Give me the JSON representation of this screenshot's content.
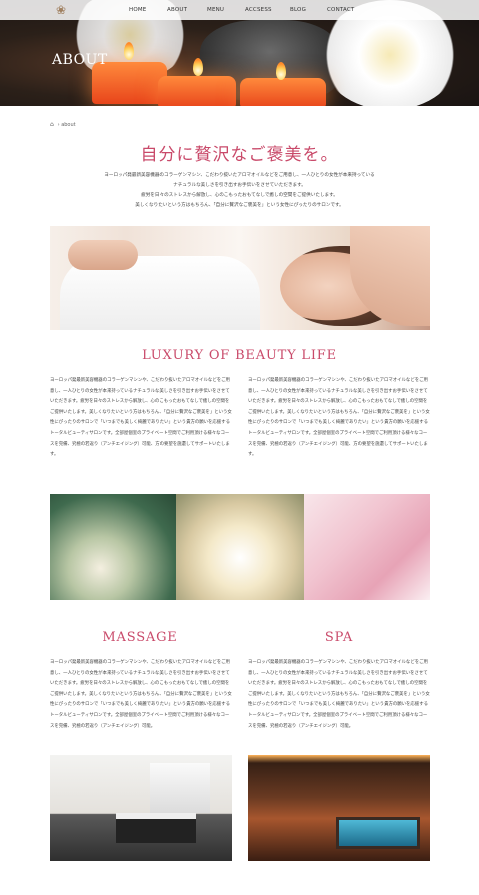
{
  "nav": {
    "items": [
      "HOME",
      "ABOUT",
      "MENU",
      "ACCSESS",
      "BLOG",
      "CONTACT"
    ]
  },
  "hero": {
    "title": "ABOUT"
  },
  "breadcrumb": {
    "current": "about"
  },
  "intro": {
    "title": "自分に贅沢なご褒美を。",
    "lines": [
      "ヨーロッパ発最新美容機器のコラーゲンマシン、こだわり抜いたアロマオイルなどをご用意し、一人ひとりの女性が本来持っている",
      "ナチュラルな美しさを引き出すお手伝いをさせていただきます。",
      "疲労を日々のストレスから解放し、心のこもったおもてなしで癒しの空間をご提供いたします。",
      "美しくなりたいという方はもちろん、「自分に贅沢なご褒美を」という女性にぴったりのサロンです。"
    ]
  },
  "luxury": {
    "title": "LUXURY OF BEAUTY LIFE",
    "left": "ヨーロッパ発最新美容機器のコラーゲンマシンや、こだわり抜いたアロマオイルなどをご用意し、一人ひとりの女性が本来持っているナチュラルな美しさを引き出すお手伝いをさせていただきます。疲労を日々のストレスから解放し、心のこもったおもてなしで癒しの空間をご提供いたします。美しくなりたいという方はもちろん、「自分に贅沢なご褒美を」という女性にぴったりのサロンで「いつまでも美しく綺麗でありたい」という貴方の願いを応援するトータルビューティサロンです。全部屋個室のプライベート空間でご利用頂ける様々なコースを完備、究極の若返り（アンチエイジング）可能、方の要望を施還してサポートいたします。",
    "right": "ヨーロッパ発最新美容機器のコラーゲンマシンや、こだわり抜いたアロマオイルなどをご用意し、一人ひとりの女性が本来持っているナチュラルな美しさを引き出すお手伝いをさせていただきます。疲労を日々のストレスから解放し、心のこもったおもてなしで癒しの空間をご提供いたします。美しくなりたいという方はもちろん、「自分に贅沢なご褒美を」という女性にぴったりのサロンで「いつまでも美しく綺麗でありたい」という貴方の願いを応援するトータルビューティサロンです。全部屋個室のプライベート空間でご利用頂ける様々なコースを完備、究極の若返り（アンチエイジング）可能、方の要望を施還してサポートいたします。"
  },
  "massage": {
    "title": "MASSAGE",
    "text": "ヨーロッパ発最新美容機器のコラーゲンマシンや、こだわり抜いたアロマオイルなどをご用意し、一人ひとりの女性が本来持っているナチュラルな美しさを引き出すお手伝いをさせていただきます。疲労を日々のストレスから解放し、心のこもったおもてなしで癒しの空間をご提供いたします。美しくなりたいという方はもちろん、「自分に贅沢なご褒美を」という女性にぴったりのサロンで「いつまでも美しく綺麗でありたい」という貴方の願いを応援するトータルビューティサロンです。全部屋個室のプライベート空間でご利用頂ける様々なコースを完備、究極の若返り（アンチエイジング）可能。"
  },
  "spa": {
    "title": "SPA",
    "text": "ヨーロッパ発最新美容機器のコラーゲンマシンや、こだわり抜いたアロマオイルなどをご用意し、一人ひとりの女性が本来持っているナチュラルな美しさを引き出すお手伝いをさせていただきます。疲労を日々のストレスから解放し、心のこもったおもてなしで癒しの空間をご提供いたします。美しくなりたいという方はもちろん、「自分に贅沢なご褒美を」という女性にぴったりのサロンで「いつまでも美しく綺麗でありたい」という貴方の願いを応援するトータルビューティサロンです。全部屋個室のプライベート空間でご利用頂ける様々なコースを完備、究極の若返り（アンチエイジング）可能。"
  },
  "colors": {
    "accent": "#c94a6a"
  },
  "icons": {
    "logo": "lotus-logo-icon",
    "home": "home-icon"
  }
}
